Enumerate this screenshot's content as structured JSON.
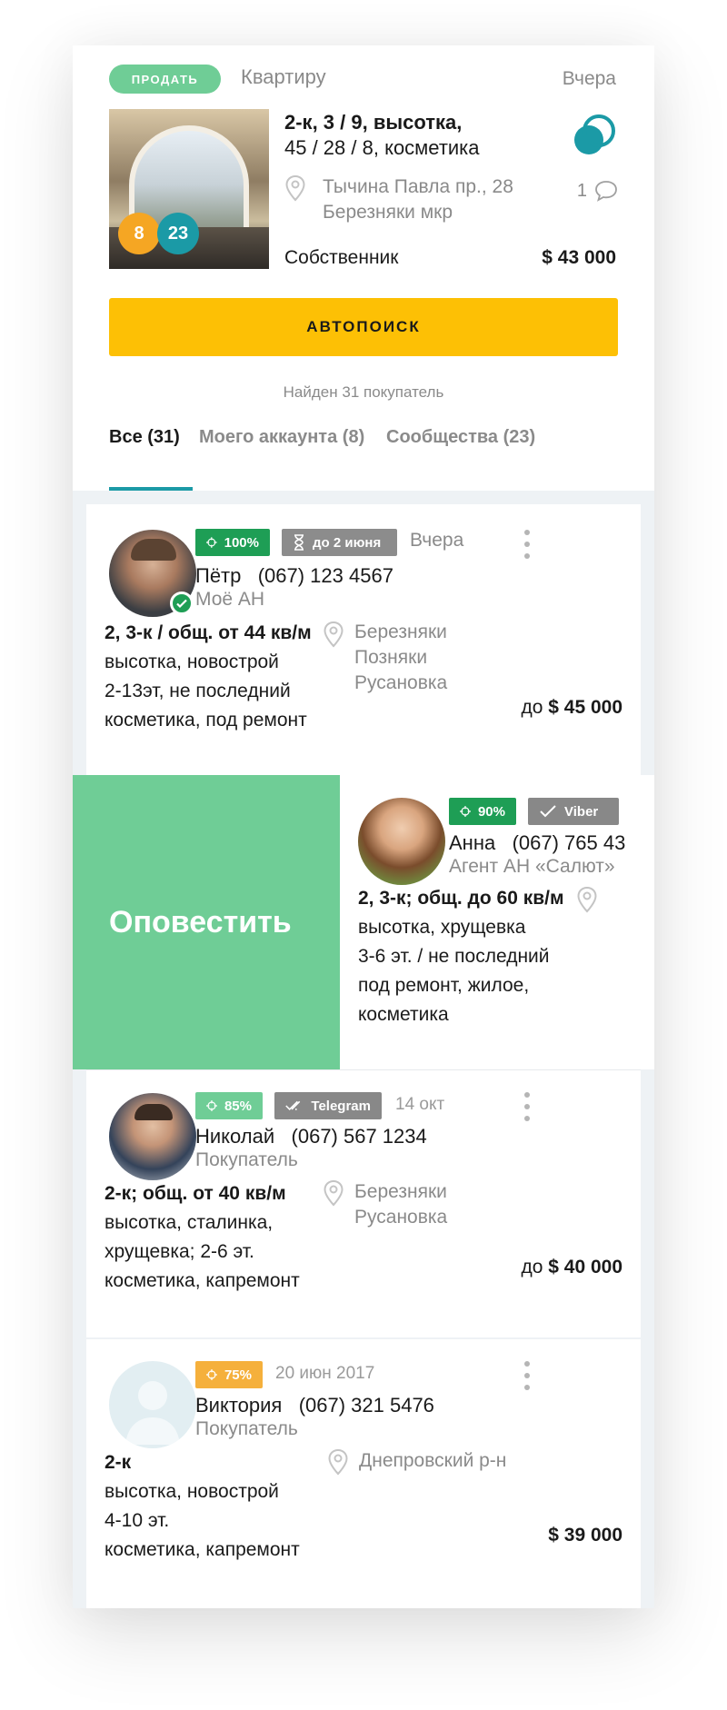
{
  "property": {
    "action": "ПРОДАТЬ",
    "type": "Квартиру",
    "date": "Вчера",
    "line1": "2-к, 3 / 9, высотка,",
    "line2": "45 / 28 / 8, косметика",
    "address1": "Тычина Павла пр., 28",
    "address2": "Березняки мкр",
    "owner": "Собственник",
    "price": "$ 43 000",
    "comments": "1",
    "badge_orange": "8",
    "badge_teal": "23"
  },
  "autosearch_label": "АВТОПОИСК",
  "found_text": "Найден 31 покупатель",
  "tabs": [
    {
      "label": "Все (31)",
      "active": true
    },
    {
      "label": "Моего аккаунта (8)",
      "active": false
    },
    {
      "label": "Сообщества (23)",
      "active": false
    }
  ],
  "notify_label": "Оповестить",
  "buyers": [
    {
      "match": "100%",
      "tag": "до 2 июня",
      "date": "Вчера",
      "name": "Пётр",
      "phone": "(067) 123 4567",
      "role": "Моё АН",
      "req_title": "2, 3-к / общ. от 44 кв/м",
      "req_lines": [
        "высотка, новострой",
        "2-13эт, не последний",
        "косметика, под ремонт"
      ],
      "locations": [
        "Березняки",
        "Позняки",
        "Русановка"
      ],
      "budget_prefix": "до",
      "budget": "$ 45 000"
    },
    {
      "match": "90%",
      "tag": "Viber",
      "name": "Анна",
      "phone": "(067) 765 43",
      "role": "Агент АН «Салют»",
      "req_title": "2, 3-к; общ. до 60 кв/м",
      "req_lines": [
        "высотка, хрущевка",
        "3-6 эт. / не последний",
        "под ремонт, жилое,",
        "косметика"
      ]
    },
    {
      "match": "85%",
      "tag": "Telegram",
      "date": "14 окт",
      "name": "Николай",
      "phone": "(067) 567 1234",
      "role": "Покупатель",
      "req_title": "2-к; общ. от 40 кв/м",
      "req_lines": [
        "высотка, сталинка,",
        "хрущевка; 2-6 эт.",
        "косметика, капремонт"
      ],
      "locations": [
        "Березняки",
        "Русановка"
      ],
      "budget_prefix": "до",
      "budget": "$ 40 000"
    },
    {
      "match": "75%",
      "date": "20 июн 2017",
      "name": "Виктория",
      "phone": "(067) 321 5476",
      "role": "Покупатель",
      "req_title": "2-к",
      "req_lines": [
        "высотка, новострой",
        "4-10 эт.",
        "косметика, капремонт"
      ],
      "locations": [
        "Днепровский р-н"
      ],
      "budget": "$ 39 000"
    }
  ],
  "colors": {
    "accent_teal": "#1b9aa6",
    "green": "#1e9e55",
    "light_green": "#6fcd96",
    "yellow": "#fdc005",
    "orange": "#f5a623"
  },
  "icons": [
    "target-icon",
    "hourglass-icon",
    "check-icon",
    "double-check-icon",
    "map-pin-icon",
    "comment-icon",
    "more-vertical-icon",
    "verified-icon"
  ]
}
